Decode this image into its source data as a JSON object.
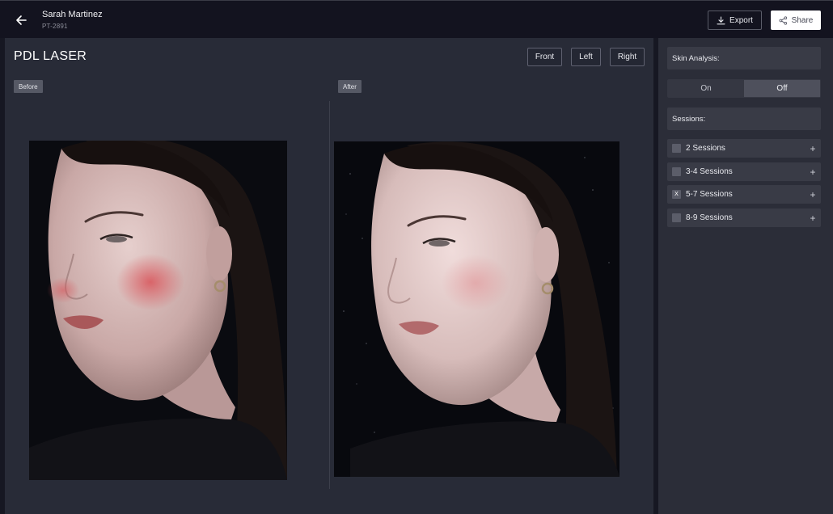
{
  "header": {
    "patient_name": "Sarah Martinez",
    "patient_id": "PT-2891",
    "export_label": "Export",
    "share_label": "Share"
  },
  "main": {
    "title": "PDL LASER",
    "views": [
      "Front",
      "Left",
      "Right"
    ],
    "before_label": "Before",
    "after_label": "After"
  },
  "sidebar": {
    "skin_analysis_label": "Skin Analysis:",
    "toggle": {
      "on": "On",
      "off": "Off",
      "selected": "Off"
    },
    "sessions_label": "Sessions:",
    "sessions": [
      {
        "label": "2 Sessions",
        "checked": false,
        "mark": ""
      },
      {
        "label": "3-4 Sessions",
        "checked": false,
        "mark": ""
      },
      {
        "label": "5-7 Sessions",
        "checked": true,
        "mark": "X"
      },
      {
        "label": "8-9 Sessions",
        "checked": false,
        "mark": ""
      }
    ]
  },
  "colors": {
    "background": "#161722",
    "panel": "#282b37",
    "sidebar": "#2b2d38",
    "accent_white": "#ffffff"
  }
}
